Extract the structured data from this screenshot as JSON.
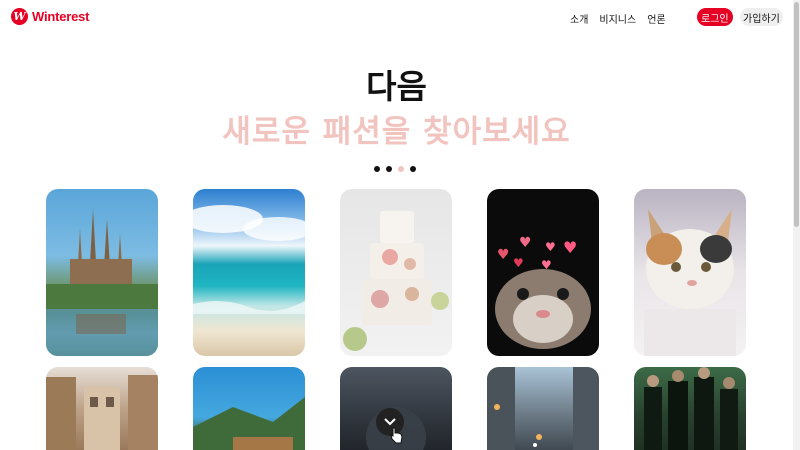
{
  "header": {
    "logo_text": "Winterest",
    "logo_mark": "W",
    "nav": [
      "소개",
      "비지니스",
      "언론"
    ],
    "login_label": "로그인",
    "signup_label": "가입하기"
  },
  "hero": {
    "title": "다음",
    "subtitle": "새로운 패션을 찾아보세요",
    "carousel": {
      "count": 4,
      "active_index": 2
    }
  },
  "cards_row1": [
    {
      "name": "sagrada-familia-photo"
    },
    {
      "name": "beach-photo"
    },
    {
      "name": "painted-cake-photo"
    },
    {
      "name": "cat-with-hearts-photo"
    },
    {
      "name": "calico-cat-photo"
    }
  ],
  "cards_row2": [
    {
      "name": "old-street-photo"
    },
    {
      "name": "coastal-town-photo"
    },
    {
      "name": "rainy-window-photo"
    },
    {
      "name": "city-street-photo"
    },
    {
      "name": "matrix-scene-photo"
    }
  ],
  "icons": {
    "scroll_hint": "chevron-down-icon",
    "cursor": "hand-pointer-icon"
  },
  "colors": {
    "brand": "#e60023",
    "subtitle": "#f2c4c0",
    "signup_bg": "#efefef"
  }
}
